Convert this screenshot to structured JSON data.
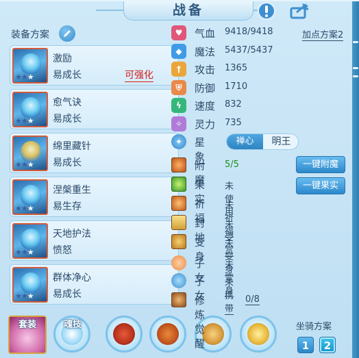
{
  "window": {
    "title": "战备"
  },
  "header": {
    "alert_icon": "exclamation-icon",
    "share_icon": "share-icon"
  },
  "equipment_plan": {
    "label": "装备方案",
    "edit_icon": "pencil-icon"
  },
  "skills": [
    {
      "name": "激励",
      "desc": "易成长",
      "tag": "可强化",
      "stars": 2
    },
    {
      "name": "愈气诀",
      "desc": "易成长",
      "tag": "",
      "stars": 2
    },
    {
      "name": "绵里藏针",
      "desc": "易成长",
      "tag": "",
      "stars": 2
    },
    {
      "name": "涅槃重生",
      "desc": "易生存",
      "tag": "",
      "stars": 2
    },
    {
      "name": "天地护法",
      "desc": "愤怒",
      "tag": "",
      "stars": 2
    },
    {
      "name": "群体净心",
      "desc": "易成长",
      "tag": "",
      "stars": 2
    }
  ],
  "bottom": {
    "set_label": "套装",
    "soul_label": "魂技",
    "mount_plan_label": "坐骑方案",
    "mount_buttons": [
      "1",
      "2"
    ]
  },
  "attributes": {
    "plan_link": "加点方案2",
    "rows": [
      {
        "name": "气血",
        "value": "9418/9418",
        "color": "#e0577a",
        "icon": "heart-icon"
      },
      {
        "name": "魔法",
        "value": "5437/5437",
        "color": "#3f9be6",
        "icon": "diamond-icon"
      },
      {
        "name": "攻击",
        "value": "1365",
        "color": "#eaa63a",
        "icon": "sword-icon"
      },
      {
        "name": "防御",
        "value": "1710",
        "color": "#e98a4a",
        "icon": "shield-icon"
      },
      {
        "name": "速度",
        "value": "832",
        "color": "#35b77c",
        "icon": "lightning-icon"
      },
      {
        "name": "灵力",
        "value": "735",
        "color": "#b07bd8",
        "icon": "spark-icon"
      }
    ],
    "star_sign": {
      "label": "星象",
      "options": [
        "禅心",
        "明王"
      ],
      "selected": "禅心"
    }
  },
  "features": {
    "rows": [
      {
        "name": "附魔",
        "value": "5/5",
        "highlight": true,
        "icon": "enchant-icon"
      },
      {
        "name": "果实",
        "value": "未使用",
        "highlight": false,
        "icon": "fruit-icon"
      },
      {
        "name": "祈福",
        "value": "未祈福",
        "highlight": false,
        "icon": "blessing-icon"
      },
      {
        "name": "封地",
        "value": "未受赏",
        "highlight": false,
        "icon": "fief-icon"
      },
      {
        "name": "变身",
        "value": "未变身",
        "highlight": false,
        "icon": "transform-icon"
      },
      {
        "name": "子女",
        "value": "未变身",
        "highlight": false,
        "icon": "child-icon"
      },
      {
        "name": "子女",
        "value": "未携带",
        "highlight": false,
        "icon": "pawprint-icon"
      },
      {
        "name": "修炼觉醒",
        "value": "0/8",
        "highlight": false,
        "icon": "cultivation-icon"
      }
    ],
    "buttons": [
      "一键附魔",
      "一键果实"
    ]
  }
}
